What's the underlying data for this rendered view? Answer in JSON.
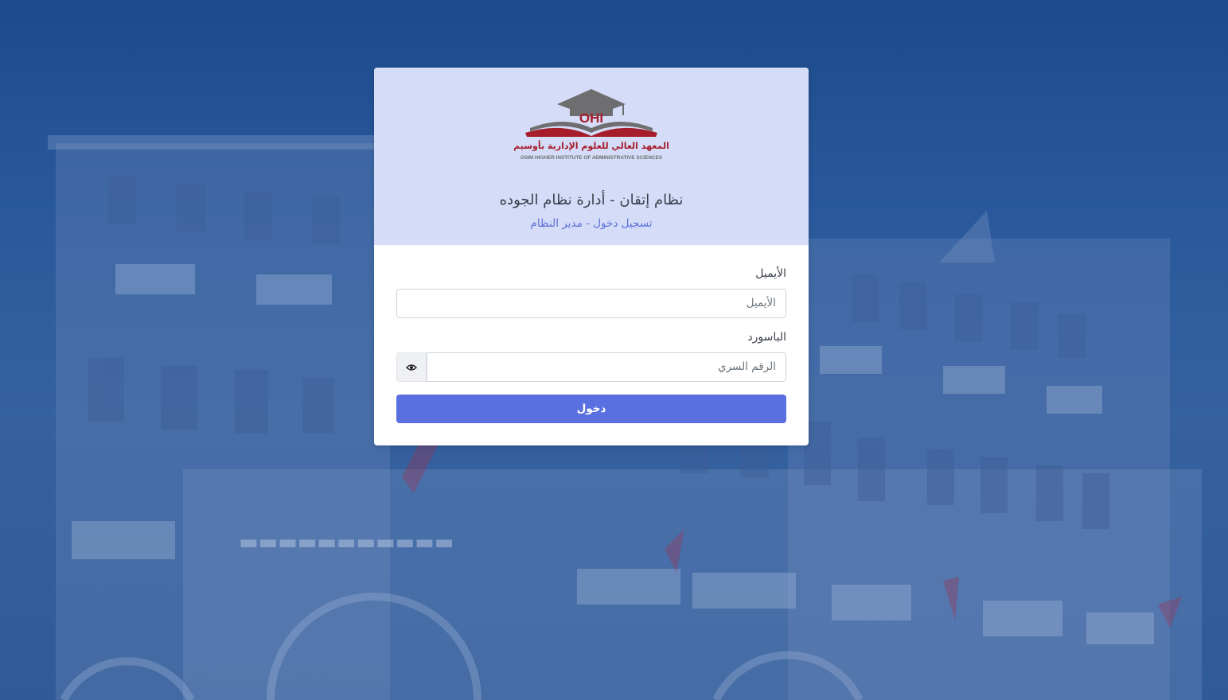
{
  "header": {
    "logo_abbr": "OHI",
    "logo_arabic": "المعهد العالي للعلوم الإدارية بأوسيم",
    "logo_english": "OSIM HIGHER INSTITUTE OF ADMINISTRATIVE SCIENCES",
    "system_title": "نظام إتقان - أدارة نظام الجوده",
    "subtitle": "تسجيل دخول - مدير النظام"
  },
  "form": {
    "email_label": "الأيميل",
    "email_placeholder": "الأيميل",
    "password_label": "الباسورد",
    "password_placeholder": "الرقم السري",
    "toggle_icon": "eye-icon",
    "submit_label": "دخول"
  },
  "colors": {
    "header_bg": "#d5dcf7",
    "accent": "#5a6fe0",
    "subtitle": "#5a6fd8",
    "background": "#2a5898"
  }
}
